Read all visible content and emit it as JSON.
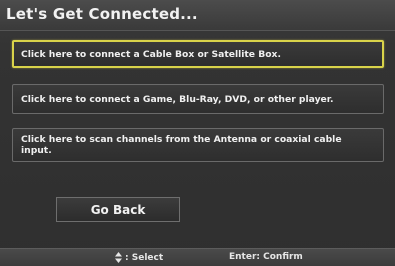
{
  "title": "Let's Get Connected...",
  "options": [
    {
      "label": "Click here to connect a Cable Box or Satellite Box.",
      "selected": true
    },
    {
      "label": "Click here to connect a Game, Blu-Ray, DVD, or other player.",
      "selected": false
    },
    {
      "label": "Click here to scan channels from the Antenna or coaxial cable input.",
      "selected": false
    }
  ],
  "back_button": {
    "label": "Go Back"
  },
  "footer": {
    "select_icon": "up-down-arrows-icon",
    "select_hint": ": Select",
    "confirm_hint": "Enter: Confirm"
  },
  "colors": {
    "selection_border": "#d9d34a",
    "background": "#2f2f2f",
    "text": "#f0f0f0"
  }
}
